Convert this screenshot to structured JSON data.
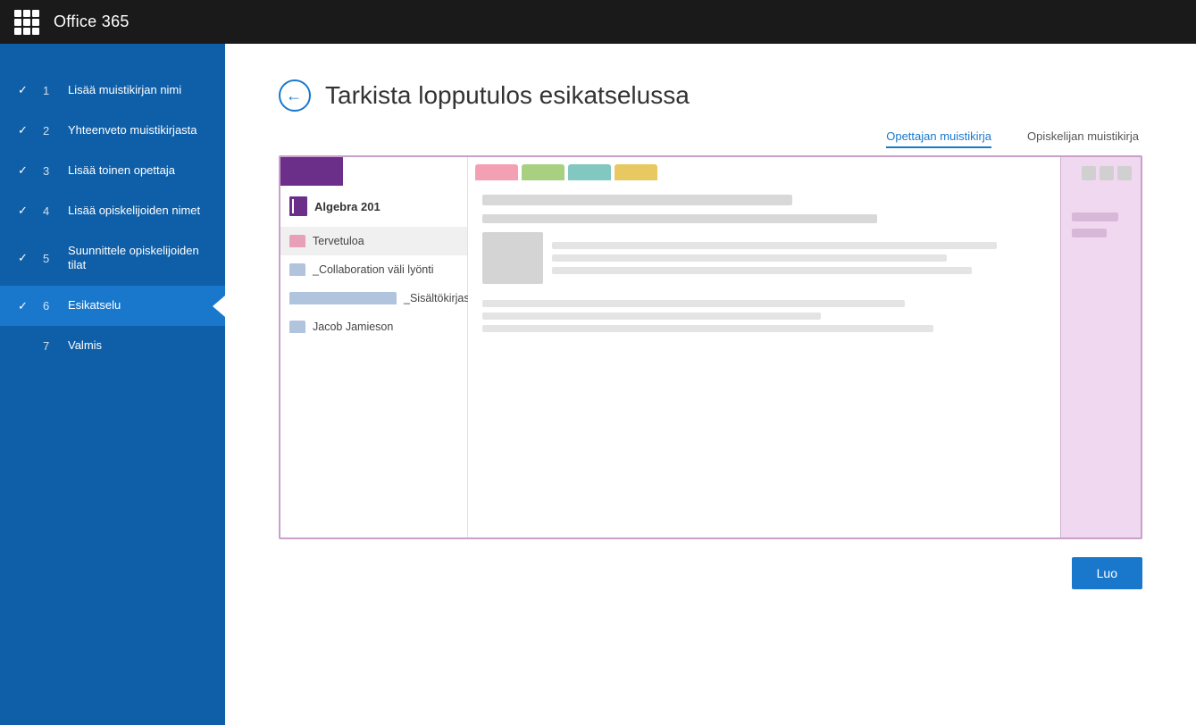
{
  "topbar": {
    "title": "Office 365"
  },
  "sidebar": {
    "items": [
      {
        "step": "1",
        "label": "Lisää muistikirjan nimi",
        "completed": true,
        "active": false
      },
      {
        "step": "2",
        "label": "Yhteenveto muistikirjasta",
        "completed": true,
        "active": false
      },
      {
        "step": "3",
        "label": "Lisää toinen opettaja",
        "completed": true,
        "active": false
      },
      {
        "step": "4",
        "label": "Lisää opiskelijoiden nimet",
        "completed": true,
        "active": false
      },
      {
        "step": "5",
        "label": "Suunnittele opiskelijoiden tilat",
        "completed": true,
        "active": false
      },
      {
        "step": "6",
        "label": "Esikatselu",
        "completed": true,
        "active": true
      },
      {
        "step": "7",
        "label": "Valmis",
        "completed": false,
        "active": false
      }
    ]
  },
  "page": {
    "title": "Tarkista lopputulos esikatselussa"
  },
  "tabs": {
    "teacher": "Opettajan muistikirja",
    "student": "Opiskelijan muistikirja"
  },
  "notebook": {
    "title": "Algebra 201",
    "sections": [
      {
        "name": "Tervetuloa",
        "type": "pink",
        "active": true
      },
      {
        "name": "_Collaboration väli lyönti",
        "type": "collab"
      },
      {
        "name": "_Sisältökirjasto",
        "type": "content"
      },
      {
        "name": "Jacob Jamieson",
        "type": "student"
      }
    ]
  },
  "buttons": {
    "create": "Luo",
    "back": "←"
  }
}
